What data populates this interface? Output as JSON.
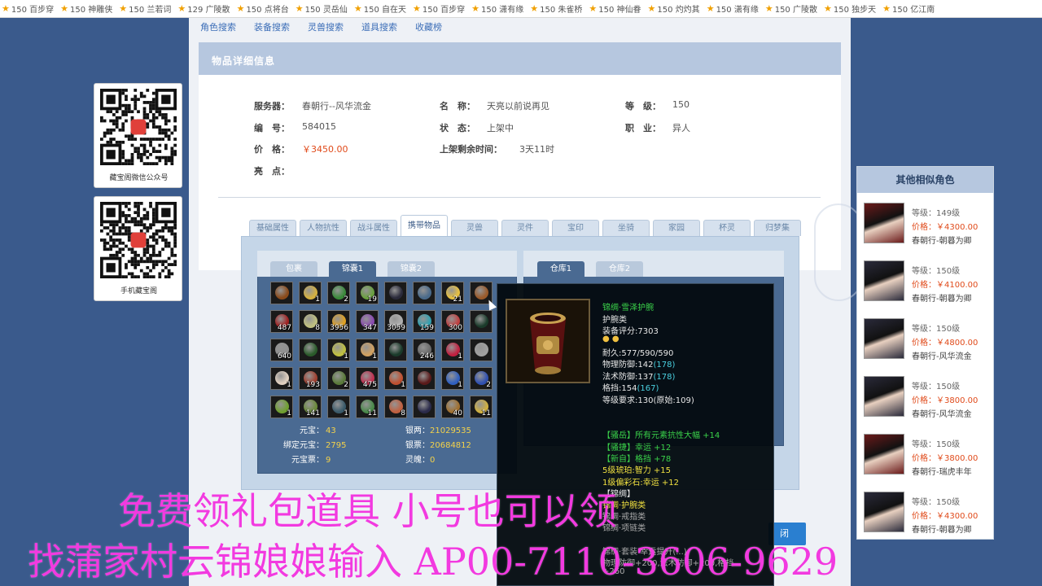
{
  "topbar": [
    "150 百步穿",
    "150 神雕侠",
    "150 兰若词",
    "129 广陵散",
    "150 点将台",
    "150 灵岳仙",
    "150 自在天",
    "150 百步穿",
    "150 潇有缘",
    "150 朱雀桥",
    "150 神仙眷",
    "150 灼灼其",
    "150 潇有缘",
    "150 广陵散",
    "150 独步天",
    "150 亿江南"
  ],
  "nav": [
    "角色搜索",
    "装备搜索",
    "灵兽搜索",
    "道具搜索",
    "收藏榜"
  ],
  "panel_title": "物品详细信息",
  "info": {
    "server_label": "服务器：",
    "server": "春朝行--风华流金",
    "name_label": "名　称：",
    "name": "天亮以前说再见",
    "level_label": "等　级：",
    "level": "150",
    "id_label": "编　号：",
    "id": "584015",
    "status_label": "状　态：",
    "status": "上架中",
    "job_label": "职　业：",
    "job": "异人",
    "price_label": "价　格：",
    "price": "￥3450.00",
    "remain_label": "上架剩余时间：",
    "remain": "3天11时",
    "highlight_label": "亮　点："
  },
  "tabs": [
    "基础属性",
    "人物抗性",
    "战斗属性",
    "携带物品",
    "灵兽",
    "灵件",
    "宝印",
    "坐骑",
    "家园",
    "杯灵",
    "归梦集"
  ],
  "bag_tabs": [
    "包裹",
    "锦囊1",
    "锦囊2"
  ],
  "warehouse_tabs": [
    "仓库1",
    "仓库2"
  ],
  "items": [
    {
      "c": "#8a4a1a",
      "n": ""
    },
    {
      "c": "#d4b040",
      "n": "1"
    },
    {
      "c": "#3a8a3a",
      "n": "2"
    },
    {
      "c": "#6aa040",
      "n": "19"
    },
    {
      "c": "#2a2a3a",
      "n": ""
    },
    {
      "c": "#4a6a8a",
      "n": ""
    },
    {
      "c": "#e8c040",
      "n": "21"
    },
    {
      "c": "#9a5a2a",
      "n": ""
    },
    {
      "c": "#a02020",
      "n": "487"
    },
    {
      "c": "#c0c080",
      "n": "8"
    },
    {
      "c": "#e0a020",
      "n": "3956"
    },
    {
      "c": "#8a4ab0",
      "n": "347"
    },
    {
      "c": "#b0b0b0",
      "n": "3059"
    },
    {
      "c": "#30a0b0",
      "n": "159"
    },
    {
      "c": "#c04040",
      "n": "300"
    },
    {
      "c": "#1a3a2a",
      "n": ""
    },
    {
      "c": "#909090",
      "n": "640"
    },
    {
      "c": "#2a5a2a",
      "n": ""
    },
    {
      "c": "#c0c040",
      "n": "1"
    },
    {
      "c": "#d0a060",
      "n": "1"
    },
    {
      "c": "#1a3a2a",
      "n": ""
    },
    {
      "c": "#6a6a6a",
      "n": "246"
    },
    {
      "c": "#c02040",
      "n": "1"
    },
    {
      "c": "#a0a0a0",
      "n": ""
    },
    {
      "c": "#e0d0c0",
      "n": "1"
    },
    {
      "c": "#a04030",
      "n": "193"
    },
    {
      "c": "#5a7a3a",
      "n": "2"
    },
    {
      "c": "#c03050",
      "n": "475"
    },
    {
      "c": "#c05030",
      "n": "1"
    },
    {
      "c": "#5a1a1a",
      "n": ""
    },
    {
      "c": "#3060c0",
      "n": "1"
    },
    {
      "c": "#3050b0",
      "n": "2"
    },
    {
      "c": "#70a030",
      "n": "1"
    },
    {
      "c": "#6a8a3a",
      "n": "141"
    },
    {
      "c": "#3a5a6a",
      "n": "1"
    },
    {
      "c": "#4a8a4a",
      "n": "11"
    },
    {
      "c": "#c06040",
      "n": "8"
    },
    {
      "c": "#2a2a4a",
      "n": ""
    },
    {
      "c": "#a07030",
      "n": "40"
    },
    {
      "c": "#d0b040",
      "n": "11"
    }
  ],
  "money": {
    "yuanbao_label": "元宝：",
    "yuanbao": "43",
    "yinliang_label": "银两：",
    "yinliang": "21029535",
    "bind_label": "绑定元宝：",
    "bind": "2795",
    "yinpiao_label": "银票：",
    "yinpiao": "20684812",
    "piao_label": "元宝票：",
    "piao": "9",
    "lingli_label": "灵魄：",
    "lingli": "0"
  },
  "tooltip": {
    "name": "锦绸·雪泽护腕",
    "type": "护腕类",
    "score": "装备评分:7303",
    "durability": "耐久:577/590/590",
    "pdef": "物理防御:142",
    "pdef_b": "(178)",
    "mdef": "法术防御:137",
    "mdef_b": "(178)",
    "block": "格挡:154",
    "block_b": "(167)",
    "req": "等级要求:130(原始:109)",
    "attr1": "【骚岳】所有元素抗性大幅 +14",
    "attr2": "【骚捷】幸运 +12",
    "attr3": "【新自】格挡 +78",
    "gem1": "5级琥珀:智力 +15",
    "gem2": "1级偏彩石:幸运 +12",
    "set_title": "【锦绸】",
    "set1": "锦绸·护腕类",
    "set2": "锦绸·戒指类",
    "set3": "锦绸·项链类",
    "tail1": "锦绸·套装·幸运提升(...)",
    "tail2": "物理防御+200,法术防御+200,格挡",
    "tail3": "+260"
  },
  "close_label": "闭",
  "qr1_caption": "藏宝阁微信公众号",
  "qr2_caption": "手机藏宝阁",
  "similar_title": "其他相似角色",
  "similar": [
    {
      "level": "等级：149级",
      "price": "价格：￥4300.00",
      "server": "春朝行-朝暮为卿",
      "skin": "#6a1a1a"
    },
    {
      "level": "等级：150级",
      "price": "价格：￥4100.00",
      "server": "春朝行-朝暮为卿",
      "skin": "#2a2a3a"
    },
    {
      "level": "等级：150级",
      "price": "价格：￥4800.00",
      "server": "春朝行-风华流金",
      "skin": "#2a2a3a"
    },
    {
      "level": "等级：150级",
      "price": "价格：￥3800.00",
      "server": "春朝行-风华流金",
      "skin": "#2a2a3a"
    },
    {
      "level": "等级：150级",
      "price": "价格：￥3800.00",
      "server": "春朝行-瑞虎丰年",
      "skin": "#6a1a1a"
    },
    {
      "level": "等级：150级",
      "price": "价格：￥4300.00",
      "server": "春朝行-朝暮为卿",
      "skin": "#2a2a3a"
    }
  ],
  "overlay_line1": "免费领礼包道具 小号也可以领",
  "overlay_line2": "找蒲家村云锦娘娘输入 AP00-7110-3606-9629"
}
